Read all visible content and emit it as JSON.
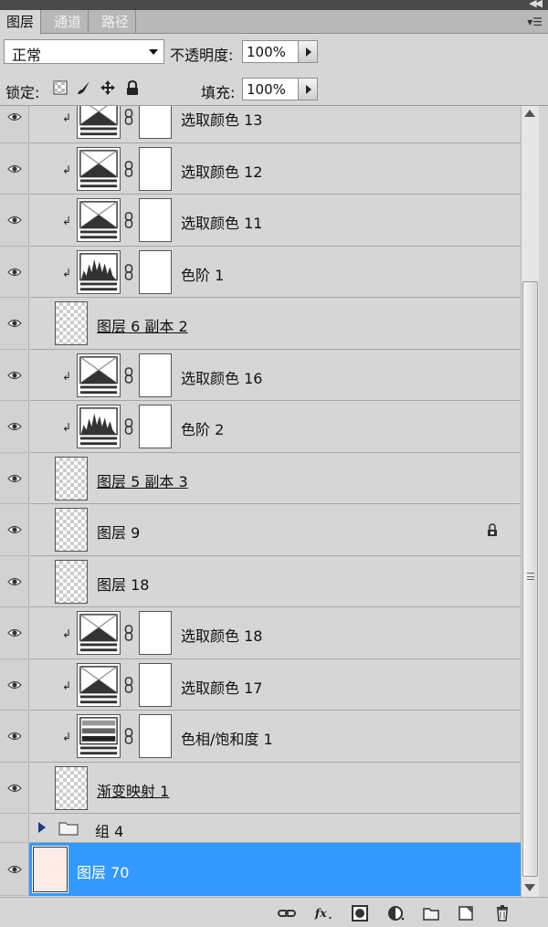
{
  "tabs": [
    "图层",
    "通道",
    "路径"
  ],
  "blend_mode": "正常",
  "opacity_label": "不透明度:",
  "opacity_value": "100%",
  "lock_label": "锁定:",
  "fill_label": "填充:",
  "fill_value": "100%",
  "group": {
    "name": "组 4"
  },
  "layers": [
    {
      "name": "选取颜色 13",
      "kind": "adjust",
      "thumb": "selective-color-icon",
      "clipped": true
    },
    {
      "name": "选取颜色 12",
      "kind": "adjust",
      "thumb": "selective-color-icon",
      "clipped": true
    },
    {
      "name": "选取颜色 11",
      "kind": "adjust",
      "thumb": "selective-color-icon",
      "clipped": true
    },
    {
      "name": "色阶 1",
      "kind": "adjust",
      "thumb": "levels-icon",
      "clipped": true
    },
    {
      "name": "图层 6 副本 2",
      "kind": "pixel",
      "underline": true
    },
    {
      "name": "选取颜色 16",
      "kind": "adjust",
      "thumb": "selective-color-icon",
      "clipped": true
    },
    {
      "name": "色阶 2",
      "kind": "adjust",
      "thumb": "levels-icon",
      "clipped": true
    },
    {
      "name": "图层 5 副本 3",
      "kind": "pixel",
      "underline": true
    },
    {
      "name": "图层 9",
      "kind": "pixel",
      "locked": true
    },
    {
      "name": "图层 18",
      "kind": "pixel"
    },
    {
      "name": "选取颜色 18",
      "kind": "adjust",
      "thumb": "selective-color-icon",
      "clipped": true
    },
    {
      "name": "选取颜色 17",
      "kind": "adjust",
      "thumb": "selective-color-icon",
      "clipped": true
    },
    {
      "name": "色相/饱和度 1",
      "kind": "adjust",
      "thumb": "hue-saturation-icon",
      "clipped": true
    },
    {
      "name": "渐变映射 1",
      "kind": "pixel",
      "underline": true
    }
  ],
  "selected_layer": {
    "name": "图层 70",
    "thumb_color": "#fdebe7"
  },
  "colors": {
    "selection": "#3399ff",
    "panel": "#d6d6d6"
  }
}
